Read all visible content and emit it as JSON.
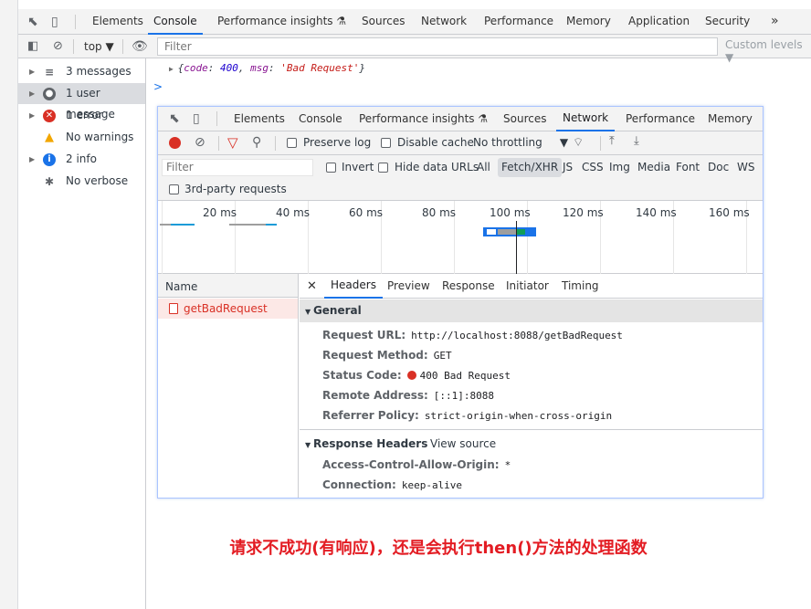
{
  "outer": {
    "tabs": [
      "Elements",
      "Console",
      "Performance insights",
      "Sources",
      "Network",
      "Performance",
      "Memory",
      "Application",
      "Security"
    ],
    "active_tab": "Console",
    "more": "»",
    "context": "top",
    "filter_placeholder": "Filter",
    "custom_levels": "Custom levels ▼",
    "sidebar": [
      {
        "label": "3 messages",
        "icon": "list-icon"
      },
      {
        "label": "1 user message",
        "icon": "user-icon"
      },
      {
        "label": "1 error",
        "icon": "error-icon"
      },
      {
        "label": "No warnings",
        "icon": "warning-icon"
      },
      {
        "label": "2 info",
        "icon": "info-icon"
      },
      {
        "label": "No verbose",
        "icon": "bug-icon"
      }
    ],
    "log": {
      "open": "{",
      "k1": "code",
      "v1": "400",
      "k2": "msg",
      "v2": "'Bad Request'",
      "close": "}"
    },
    "prompt": ">"
  },
  "inner": {
    "tabs": [
      "Elements",
      "Console",
      "Performance insights",
      "Sources",
      "Network",
      "Performance",
      "Memory"
    ],
    "active_tab": "Network",
    "toolbar": {
      "preserve_log": "Preserve log",
      "disable_cache": "Disable cache",
      "throttling": "No throttling"
    },
    "filter": {
      "placeholder": "Filter",
      "invert": "Invert",
      "hide_data_urls": "Hide data URLs",
      "types": [
        "All",
        "Fetch/XHR",
        "JS",
        "CSS",
        "Img",
        "Media",
        "Font",
        "Doc",
        "WS"
      ],
      "active_type": "Fetch/XHR",
      "third_party": "3rd-party requests"
    },
    "timeline_ticks": [
      "20 ms",
      "40 ms",
      "60 ms",
      "80 ms",
      "100 ms",
      "120 ms",
      "140 ms",
      "160 ms"
    ],
    "name_header": "Name",
    "request_name": "getBadRequest",
    "detail_tabs": [
      "Headers",
      "Preview",
      "Response",
      "Initiator",
      "Timing"
    ],
    "active_detail_tab": "Headers",
    "general": {
      "title": "General",
      "rows": [
        {
          "k": "Request URL:",
          "v": "http://localhost:8088/getBadRequest"
        },
        {
          "k": "Request Method:",
          "v": "GET"
        },
        {
          "k": "Status Code:",
          "v": "400 Bad Request"
        },
        {
          "k": "Remote Address:",
          "v": "[::1]:8088"
        },
        {
          "k": "Referrer Policy:",
          "v": "strict-origin-when-cross-origin"
        }
      ]
    },
    "response_headers": {
      "title": "Response Headers",
      "view_source": "View source",
      "rows": [
        {
          "k": "Access-Control-Allow-Origin:",
          "v": "*"
        },
        {
          "k": "Connection:",
          "v": "keep-alive"
        }
      ]
    }
  },
  "caption": "请求不成功(有响应)，还是会执行then()方法的处理函数",
  "colors": {
    "accent": "#1a73e8",
    "error": "#d93025",
    "caption": "#e31c23"
  }
}
